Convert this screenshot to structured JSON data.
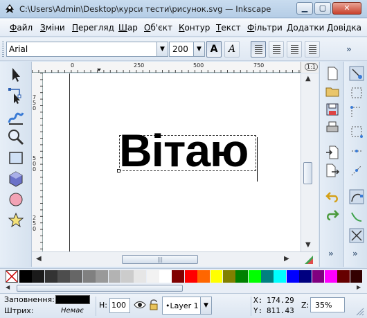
{
  "window": {
    "title": "C:\\Users\\Admin\\Desktop\\курси тести\\рисунок.svg — Inkscape",
    "buttons": {
      "minimize": "▁",
      "maximize": "▢",
      "close": "✕"
    }
  },
  "menu": [
    {
      "label": "Файл",
      "accel": "Ф",
      "rest": "айл"
    },
    {
      "label": "Зміни",
      "accel": "З",
      "rest": "міни"
    },
    {
      "label": "Перегляд",
      "accel": "П",
      "rest": "ерегляд"
    },
    {
      "label": "Шар",
      "accel": "Ш",
      "rest": "ар"
    },
    {
      "label": "Об'єкт",
      "accel": "О",
      "rest": "б'єкт"
    },
    {
      "label": "Контур",
      "accel": "К",
      "rest": "онтур"
    },
    {
      "label": "Текст",
      "accel": "Т",
      "rest": "екст"
    },
    {
      "label": "Фільтри",
      "accel": "Ф",
      "rest": "ільтри"
    },
    {
      "label": "Додатки",
      "accel": "Д",
      "rest": "одатки"
    },
    {
      "label": "Довідка",
      "accel": "Д",
      "rest": "овідка"
    }
  ],
  "text_toolbar": {
    "font_family": "Arial",
    "font_size": "200",
    "bold_label": "A",
    "italic_label": "A",
    "overflow": "»"
  },
  "rulers": {
    "h_labels": [
      "0",
      "250",
      "500",
      "750"
    ],
    "v_labels": [
      "750",
      "500",
      "250"
    ],
    "zoom_corner": "1:1"
  },
  "canvas": {
    "text": "Вітаю"
  },
  "palette": {
    "colors": [
      "#000000",
      "#1a1a1a",
      "#333333",
      "#4d4d4d",
      "#666666",
      "#808080",
      "#999999",
      "#b3b3b3",
      "#cccccc",
      "#e6e6e6",
      "#f2f2f2",
      "#ffffff",
      "#800000",
      "#ff0000",
      "#ff6600",
      "#ffff00",
      "#808000",
      "#008000",
      "#00ff00",
      "#008080",
      "#00ffff",
      "#0000ff",
      "#000080",
      "#800080",
      "#ff00ff",
      "#660000",
      "#330000"
    ]
  },
  "status": {
    "fill_label": "Заповнення:",
    "stroke_label": "Штрих:",
    "stroke_value": "Немає",
    "h_label": "H:",
    "h_value": "100",
    "layer": "•Layer 1",
    "x_label": "X:",
    "x_value": "174.29",
    "y_label": "Y:",
    "y_value": "811.43",
    "z_label": "Z:",
    "zoom": "35%"
  }
}
